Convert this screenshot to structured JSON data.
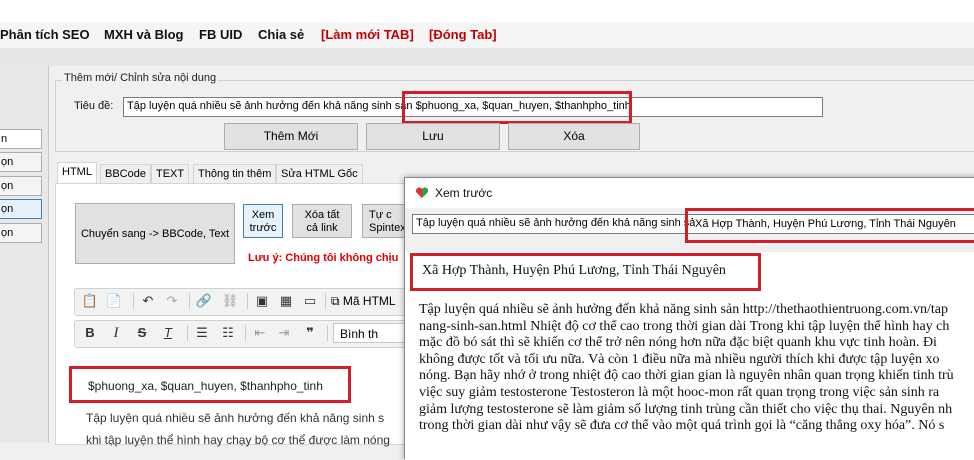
{
  "menu": {
    "items": [
      "Phân tích SEO",
      "MXH và Blog",
      "FB UID",
      "Chia sẻ"
    ],
    "refresh_tab": "[Làm mới TAB]",
    "close_tab": "[Đóng Tab]"
  },
  "left_panel": {
    "items": [
      "n",
      "ọn",
      "ọn",
      "ọn",
      "ọn"
    ]
  },
  "group": {
    "title": "Thêm mới/ Chỉnh sửa nội dung",
    "title_label": "Tiêu đề:",
    "title_value": "Tập luyện quá nhiều sẽ ảnh hưởng đến khả năng sinh sản $phuong_xa, $quan_huyen, $thanhpho_tinh",
    "add_button": "Thêm Mới",
    "save_button": "Lưu",
    "delete_button": "Xóa"
  },
  "tabs": [
    "HTML",
    "BBCode",
    "TEXT",
    "Thông tin thêm",
    "Sửa HTML Gốc"
  ],
  "html_tab": {
    "convert_button": "Chuyển sang -> BBCode, Text",
    "preview_button_line1": "Xem",
    "preview_button_line2": "trước",
    "clear_button_line1": "Xóa tất",
    "clear_button_line2": "cả link",
    "spintex_button_line1": "Tự c",
    "spintex_button_line2": "Spintex",
    "note": "Lưu ý: Chúng tôi không chịu",
    "source_label": "Mã HTML",
    "format_label": "Bình th",
    "editor_highlight": "$phuong_xa, $quan_huyen, $thanhpho_tinh",
    "editor_line1": "Tập luyện quá nhiều sẽ ảnh hưởng đến khả năng sinh s",
    "editor_line2": "khi tập luyện thể hình hay chạy bộ cơ thể được làm nóng"
  },
  "preview": {
    "window_title": "Xem trước",
    "title_field": "Tập luyện quá nhiều sẽ ảnh hưởng đến khả năng sinh sản Xã Hợp Thành, Huyện Phú Lương, Tỉnh Thái Nguyên",
    "title_field_visible": "Tập luyện quá nhiều sẽ ảnh hưởng đến khả năng sinh sả",
    "title_highlight": "Xã Hợp Thành, Huyện Phú Lương, Tỉnh Thái Nguyên",
    "heading": "Xã Hợp Thành, Huyện Phú Lương, Tỉnh Thái Nguyên",
    "body_lines": [
      "Tập luyện quá nhiều sẽ ảnh hưởng đến khả năng sinh sản http://thethaothientruong.com.vn/tap",
      "nang-sinh-san.html Nhiệt độ cơ thể cao trong thời gian dài Trong khi tập luyện thể hình hay ch",
      "mặc đồ bó sát thì sẽ khiến cơ thể trở nên nóng hơn nữa đặc biệt quanh khu vực tinh hoàn. Đi",
      "không được tốt và tối ưu nữa. Và còn 1 điều nữa mà nhiều người thích khi được tập luyện xo",
      "nóng. Bạn hãy nhớ ở trong nhiệt độ cao thời gian gian là nguyên nhân quan trọng khiến tinh trù",
      "việc suy giảm testosterone Testosteron là một hooc-mon rất quan trọng trong việc sản sinh ra",
      "giảm lượng testosterone sẽ làm giảm số lượng tinh trùng cần thiết cho việc thụ thai. Nguyên nh",
      "trong thời gian dài như vậy sẽ đưa cơ thể vào một quá trình gọi là “căng thẳng oxy hóa”. Nó s"
    ]
  },
  "colors": {
    "highlight_red": "#d21d2a",
    "menu_red": "#c00000"
  }
}
